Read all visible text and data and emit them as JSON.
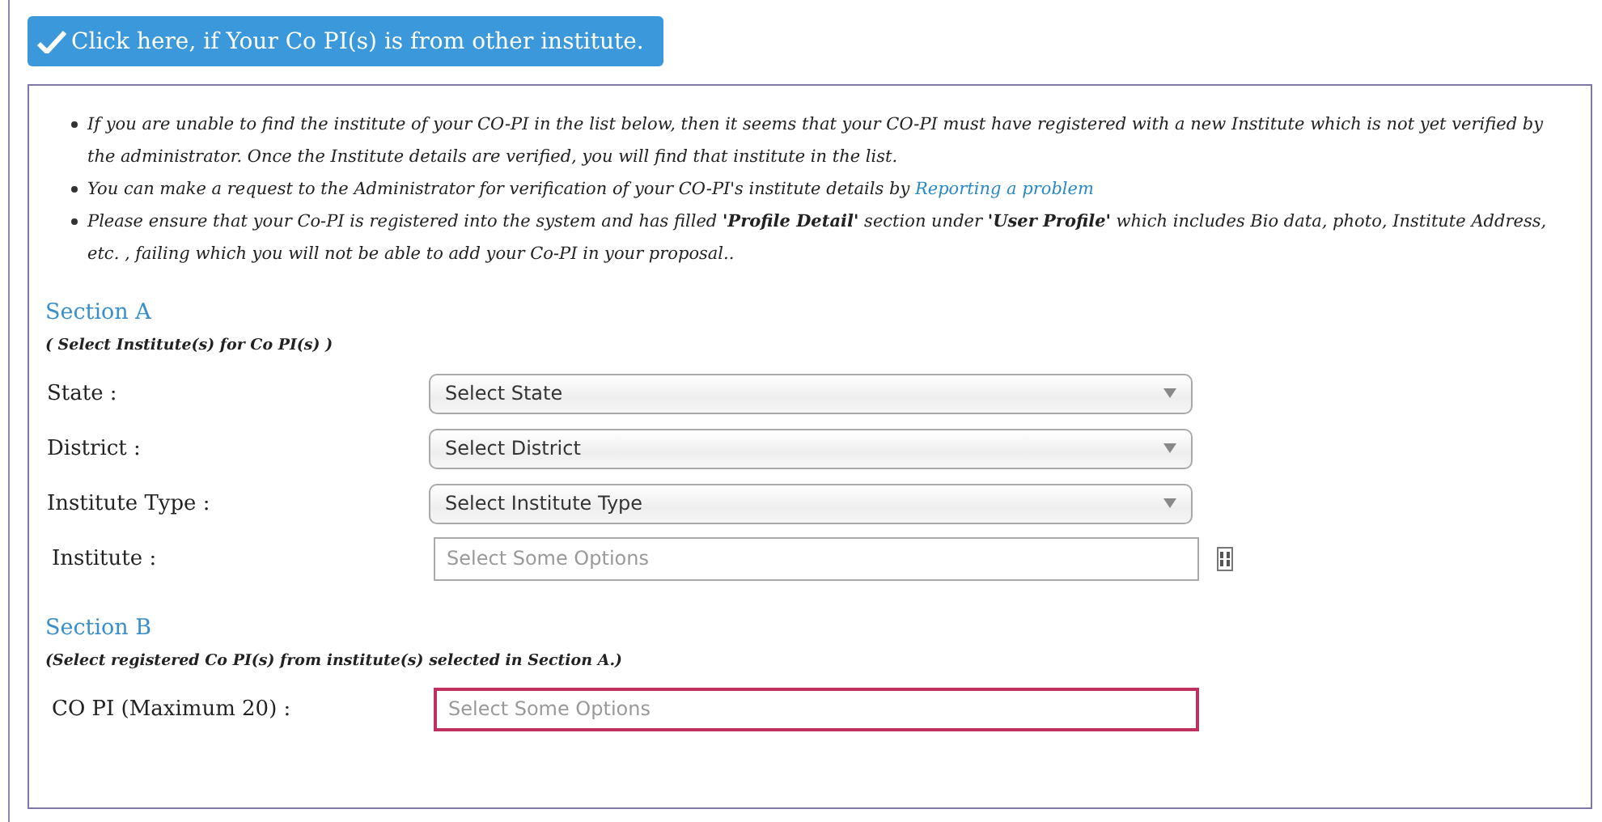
{
  "toggle_button": {
    "label": "Click here, if Your Co PI(s) is from other institute.",
    "checked": true
  },
  "notes": [
    {
      "parts": [
        {
          "text": "If you are unable to find the institute of your CO-PI in the list below, then it seems that your CO-PI must have registered with a new Institute which is not yet verified by the administrator. Once the Institute details are verified, you will find that institute in the list.",
          "kind": "text"
        }
      ]
    },
    {
      "parts": [
        {
          "text": "You can make a request to the Administrator for verification of your CO-PI's institute details by ",
          "kind": "text"
        },
        {
          "text": "Reporting a problem",
          "kind": "link"
        }
      ]
    },
    {
      "parts": [
        {
          "text": "Please ensure that your Co-PI is registered into the system and has filled **'Profile Detail'** section under **'User Profile'** which includes Bio data, photo, Institute Address, etc. , failing which you will not be able to add your Co-PI in your proposal..",
          "kind": "text"
        }
      ]
    }
  ],
  "sections": [
    {
      "title": "Section A",
      "hint": "( Select Institute(s) for Co PI(s) )",
      "fields": [
        {
          "label": "State :",
          "kind": "select",
          "value": "Select State"
        },
        {
          "label": "District :",
          "kind": "select",
          "value": "Select District"
        },
        {
          "label": "Institute Type :",
          "kind": "select",
          "value": "Select Institute Type"
        },
        {
          "label": "Institute :",
          "kind": "multiselect",
          "placeholder": "Select Some Options",
          "error": false,
          "glyph": true
        }
      ]
    },
    {
      "title": "Section B",
      "hint": "(Select registered Co PI(s) from institute(s) selected in Section A.)",
      "fields": [
        {
          "label": "CO PI (Maximum 20) :",
          "kind": "multiselect",
          "placeholder": "Select Some Options",
          "error": true
        }
      ]
    }
  ]
}
